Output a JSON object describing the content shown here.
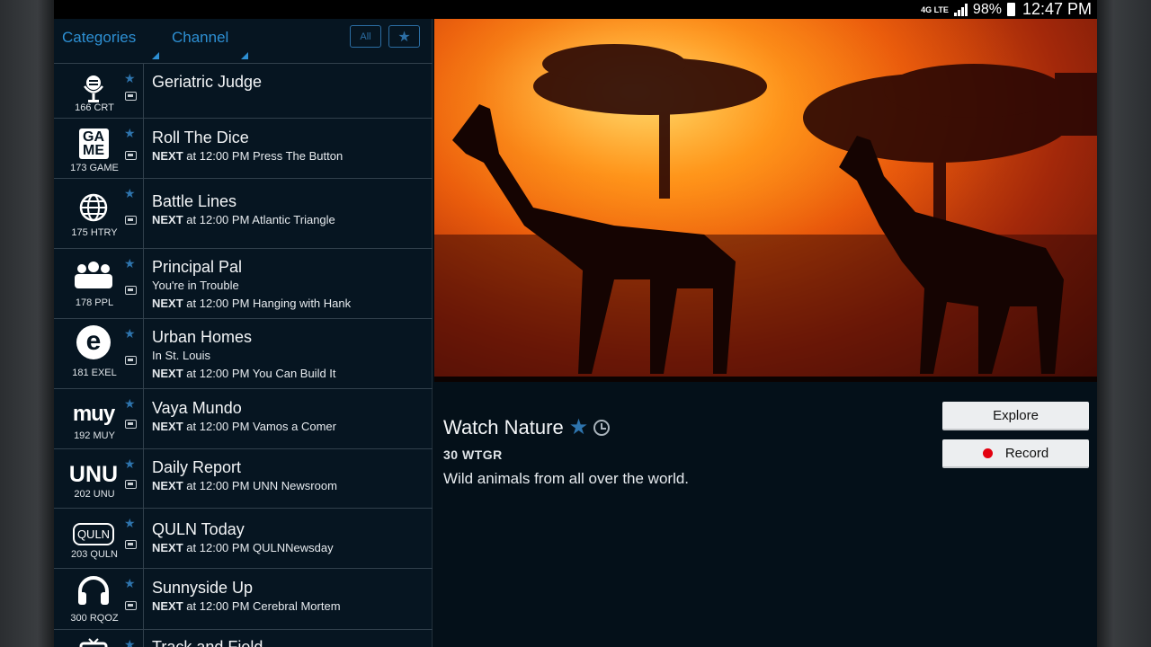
{
  "status_bar": {
    "network": "4G LTE",
    "battery": "98%",
    "time": "12:47 PM"
  },
  "filters": {
    "categories_label": "Categories",
    "channel_label": "Channel",
    "all_label": "All"
  },
  "channels": [
    {
      "name": "Geriatric Judge",
      "sub": "",
      "next_label": "",
      "next_text": "",
      "number": "166 CRT",
      "logo": "microphone-icon"
    },
    {
      "name": "Roll The Dice",
      "sub": "",
      "next_label": "NEXT",
      "next_text": "at 12:00 PM Press The Button",
      "number": "173 GAME",
      "logo_text": "GA ME"
    },
    {
      "name": "Battle Lines",
      "sub": "",
      "next_label": "NEXT",
      "next_text": "at 12:00 PM Atlantic Triangle",
      "number": "175 HTRY",
      "logo": "globe-icon"
    },
    {
      "name": "Principal Pal",
      "sub": "You're in Trouble",
      "next_label": "NEXT",
      "next_text": "at 12:00 PM Hanging with Hank",
      "number": "178 PPL",
      "logo": "people-icon"
    },
    {
      "name": "Urban Homes",
      "sub": "In St. Louis",
      "next_label": "NEXT",
      "next_text": "at 12:00 PM You Can Build It",
      "number": "181 EXEL",
      "logo_text": "e"
    },
    {
      "name": "Vaya Mundo",
      "sub": "",
      "next_label": "NEXT",
      "next_text": "at 12:00 PM Vamos a Comer",
      "number": "192 MUY",
      "logo_text": "muy"
    },
    {
      "name": "Daily Report",
      "sub": "",
      "next_label": "NEXT",
      "next_text": "at 12:00 PM UNN Newsroom",
      "number": "202 UNU",
      "logo_text": "UNU"
    },
    {
      "name": "QULN Today",
      "sub": "",
      "next_label": "NEXT",
      "next_text": "at 12:00 PM QULNNewsday",
      "number": "203 QULN",
      "logo_text": "QULN"
    },
    {
      "name": "Sunnyside Up",
      "sub": "",
      "next_label": "NEXT",
      "next_text": "at 12:00 PM Cerebral Mortem",
      "number": "300 RQOZ",
      "logo": "headphones-icon"
    },
    {
      "name": "Track and Field",
      "sub": "",
      "next_label": "",
      "next_text": "",
      "number": "",
      "logo": "tv-icon"
    }
  ],
  "detail": {
    "title": "Watch Nature",
    "channel": "30 WTGR",
    "description": "Wild animals from all over the world.",
    "explore_label": "Explore",
    "record_label": "Record"
  },
  "colors": {
    "accent": "#2d8fd3",
    "background": "#041019",
    "record": "#e3000f"
  }
}
